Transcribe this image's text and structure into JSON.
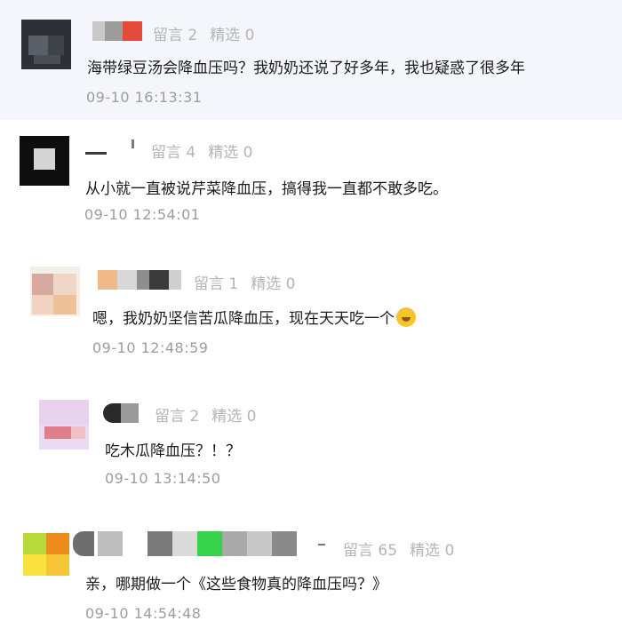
{
  "comments": [
    {
      "reply_count": "留言 2",
      "selected_count": "精选 0",
      "content": "海带绿豆汤会降血压吗？我奶奶还说了好多年，我也疑惑了很多年",
      "time": "09-10 16:13:31"
    },
    {
      "reply_count": "留言 4",
      "selected_count": "精选 0",
      "content": "从小就一直被说芹菜降血压，搞得我一直都不敢多吃。",
      "time": "09-10 12:54:01"
    },
    {
      "reply_count": "留言 1",
      "selected_count": "精选 0",
      "content": "嗯，我奶奶坚信苦瓜降血压，现在天天吃一个",
      "time": "09-10 12:48:59"
    },
    {
      "reply_count": "留言 2",
      "selected_count": "精选 0",
      "content": "吃木瓜降血压？！？",
      "time": "09-10 13:14:50"
    },
    {
      "reply_count": "留言 65",
      "selected_count": "精选 0",
      "content": "亲，哪期做一个《这些食物真的降血压吗？》",
      "time": "09-10 14:54:48"
    }
  ],
  "icons": {
    "emoji": "laughing-crying-emoji-icon"
  }
}
